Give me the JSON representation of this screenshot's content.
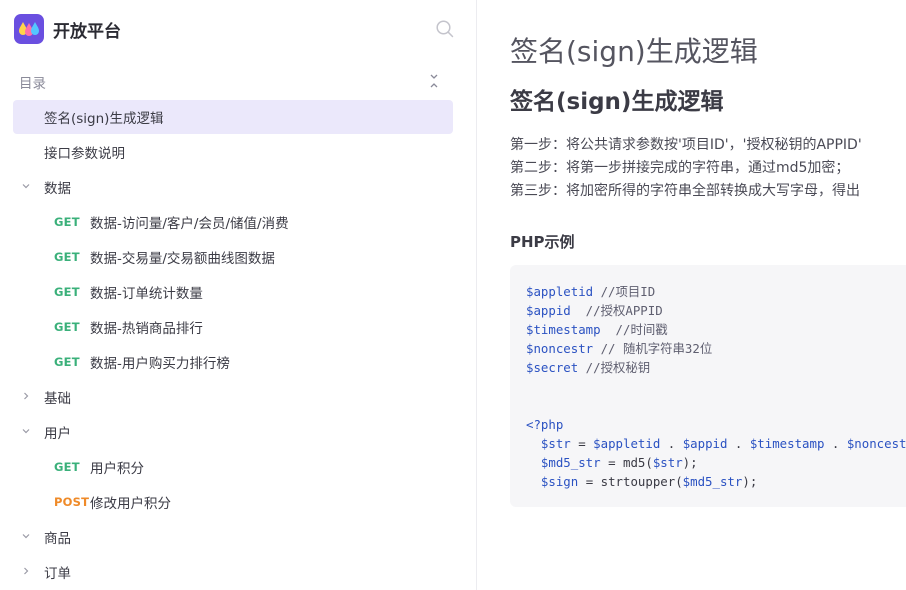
{
  "brand": {
    "name": "开放平台"
  },
  "toc": {
    "label": "目录"
  },
  "nav": {
    "items": [
      {
        "label": "签名(sign)生成逻辑"
      },
      {
        "label": "接口参数说明"
      },
      {
        "label": "数据"
      },
      {
        "method": "GET",
        "label": "数据-访问量/客户/会员/储值/消费"
      },
      {
        "method": "GET",
        "label": "数据-交易量/交易额曲线图数据"
      },
      {
        "method": "GET",
        "label": "数据-订单统计数量"
      },
      {
        "method": "GET",
        "label": "数据-热销商品排行"
      },
      {
        "method": "GET",
        "label": "数据-用户购买力排行榜"
      },
      {
        "label": "基础"
      },
      {
        "label": "用户"
      },
      {
        "method": "GET",
        "label": "用户积分"
      },
      {
        "method": "POST",
        "label": "修改用户积分"
      },
      {
        "label": "商品"
      },
      {
        "label": "订单"
      }
    ]
  },
  "main": {
    "page_title": "签名(sign)生成逻辑",
    "doc_heading": {
      "part1": "签名",
      "part2": "(sign)",
      "part3": "生成逻辑"
    },
    "steps": [
      "第一步：将公共请求参数按'项目ID'，'授权秘钥的APPID'",
      "第二步：将第一步拼接完成的字符串，通过md5加密；",
      "第三步：将加密所得的字符串全部转换成大写字母，得出"
    ],
    "php_heading": "PHP示例",
    "code_lines": {
      "l1v": "$appletid",
      "l1c": " //项目ID",
      "l2v": "$appid",
      "l2c": "  //授权APPID",
      "l3v": "$timestamp",
      "l3c": "  //时间戳",
      "l4v": "$noncestr",
      "l4c": " // 随机字符串32位",
      "l5v": "$secret",
      "l5c": " //授权秘钥",
      "l6": "<?php",
      "l7a": "$str",
      "l7b": " = ",
      "l7c": "$appletid",
      "l7d": " . ",
      "l7e": "$appid",
      "l7f": " . ",
      "l7g": "$timestamp",
      "l7h": " . ",
      "l7i": "$noncest",
      "l8a": "$md5_str",
      "l8b": " = md5(",
      "l8c": "$str",
      "l8d": ");",
      "l9a": "$sign",
      "l9b": " = strtoupper(",
      "l9c": "$md5_str",
      "l9d": ");"
    }
  },
  "colors": {
    "accent": "#6a4fe0",
    "active_bg": "#ebe8fb",
    "get": "#3ab07a",
    "post": "#ef8a28"
  },
  "icons": {
    "brand": "droplets-logo",
    "search": "search-icon",
    "toc_toggle": "collapse-icon",
    "group_expanded": "chevron-down-icon",
    "group_collapsed": "chevron-right-icon"
  }
}
